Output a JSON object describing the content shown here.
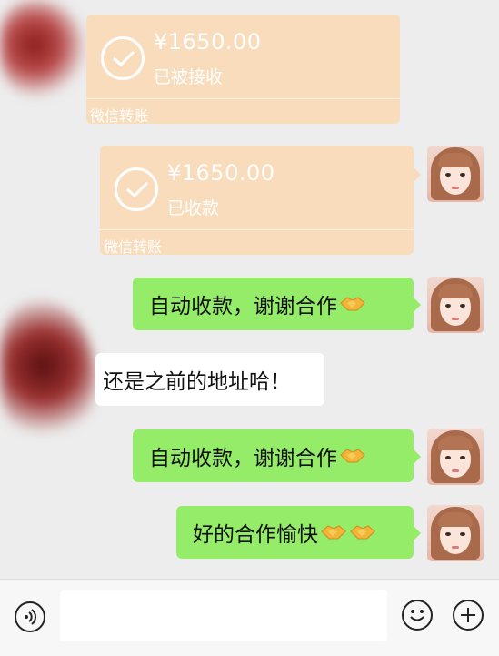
{
  "chat": {
    "transfers": [
      {
        "amount": "¥1650.00",
        "status": "已被接收",
        "footer": "微信转账"
      },
      {
        "amount": "¥1650.00",
        "status": "已收款",
        "footer": "微信转账"
      }
    ],
    "messages": [
      {
        "text": "自动收款，谢谢合作",
        "emoji": "handshake"
      },
      {
        "text": "还是之前的地址哈！"
      },
      {
        "text": "自动收款，谢谢合作",
        "emoji": "handshake"
      },
      {
        "text": "好的合作愉快",
        "emoji": "handshake x2"
      }
    ]
  },
  "colors": {
    "background": "#ededed",
    "transfer_bubble": "#f9dcbc",
    "sent_bubble": "#95ec69",
    "received_bubble": "#ffffff"
  },
  "icons": {
    "voice": "voice-icon",
    "emoji": "smiley-icon",
    "more": "plus-icon",
    "check": "check-icon",
    "handshake": "handshake-icon"
  }
}
